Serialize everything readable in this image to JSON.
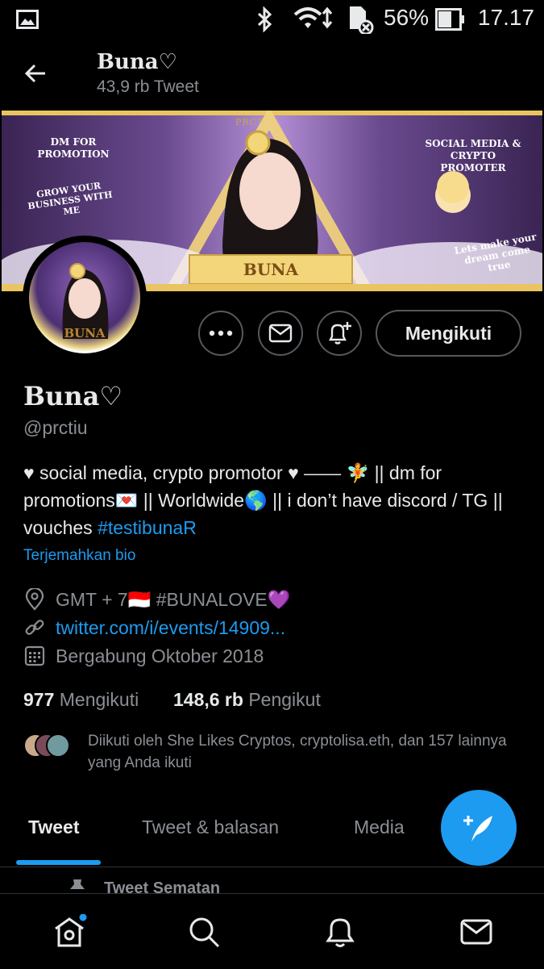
{
  "status_bar": {
    "battery_percent": "56%",
    "time": "17.17",
    "icons": [
      "image-icon",
      "bluetooth-icon",
      "wifi-icon",
      "sd-card-icon",
      "battery-icon"
    ]
  },
  "header": {
    "back_icon": "arrow-left-icon",
    "title": "Buna♡",
    "tweet_count": "43,9 rb Tweet"
  },
  "banner": {
    "brand": "PRCTIU",
    "left_tag": "DM FOR PROMOTION",
    "left_ribbon": "GROW YOUR BUSINESS WITH ME",
    "right_tag": "SOCIAL MEDIA & CRYPTO PROMOTER",
    "right_ribbon": "Lets make your dream come true",
    "name_plate": "BUNA"
  },
  "avatar": {
    "label": "BUNA"
  },
  "actions": {
    "more_icon": "more-horizontal-icon",
    "message_icon": "envelope-icon",
    "notify_icon": "bell-plus-icon",
    "follow_label": "Mengikuti"
  },
  "profile": {
    "name": "Buna♡",
    "handle": "@prctiu",
    "bio_text": "♥ social media, crypto promotor ♥ —— 🧚 || dm for promotions💌 || Worldwide🌎 || i don’t have discord / TG || vouches ",
    "bio_hashtag": "#testibunaR",
    "translate_label": "Terjemahkan bio",
    "location": "GMT + 7🇮🇩 #BUNALOVE💜",
    "link": "twitter.com/i/events/14909...",
    "joined": "Bergabung Oktober 2018",
    "following_count": "977",
    "following_label": "Mengikuti",
    "followers_count": "148,6 rb",
    "followers_label": "Pengikut",
    "followed_by": "Diikuti oleh She Likes Cryptos, cryptolisa.eth, dan 157 lainnya yang Anda ikuti"
  },
  "tabs": [
    {
      "label": "Tweet",
      "active": true
    },
    {
      "label": "Tweet & balasan",
      "active": false
    },
    {
      "label": "Media",
      "active": false
    }
  ],
  "fab_icon": "compose-tweet-icon",
  "pinned_label": "Tweet Sematan",
  "bottom_nav": [
    {
      "icon": "home-icon",
      "has_dot": true
    },
    {
      "icon": "search-icon"
    },
    {
      "icon": "bell-icon"
    },
    {
      "icon": "envelope-icon"
    }
  ],
  "colors": {
    "accent": "#1d9bf0",
    "muted": "#8b8f94",
    "text": "#e7e9ea",
    "background": "#000000"
  }
}
